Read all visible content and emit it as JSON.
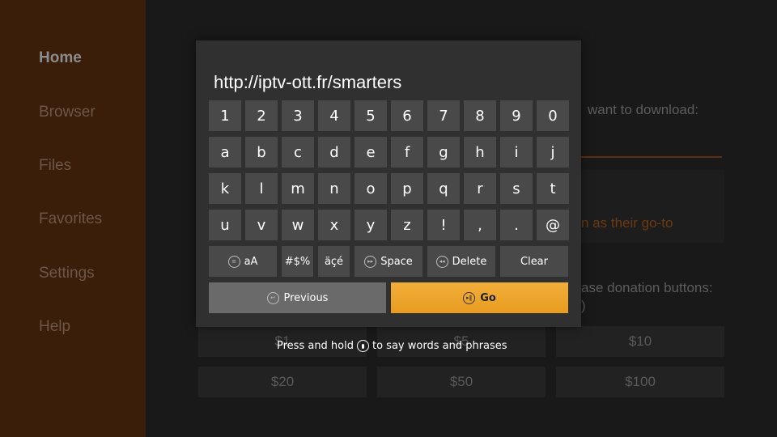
{
  "sidebar": {
    "items": [
      {
        "label": "Home",
        "active": true
      },
      {
        "label": "Browser"
      },
      {
        "label": "Files"
      },
      {
        "label": "Favorites"
      },
      {
        "label": "Settings"
      },
      {
        "label": "Help"
      }
    ]
  },
  "background": {
    "download_prompt": "want to download:",
    "go_to_text": "n as their go-to",
    "donation_prompt": "ase donation buttons:",
    "donation_paren": ")",
    "donations": [
      "$1",
      "$5",
      "$10",
      "$20",
      "$50",
      "$100"
    ]
  },
  "dialog": {
    "url": "http://iptv-ott.fr/smarters",
    "rows": [
      [
        "1",
        "2",
        "3",
        "4",
        "5",
        "6",
        "7",
        "8",
        "9",
        "0"
      ],
      [
        "a",
        "b",
        "c",
        "d",
        "e",
        "f",
        "g",
        "h",
        "i",
        "j"
      ],
      [
        "k",
        "l",
        "m",
        "n",
        "o",
        "p",
        "q",
        "r",
        "s",
        "t"
      ],
      [
        "u",
        "v",
        "w",
        "x",
        "y",
        "z",
        "!",
        ",",
        ".",
        "@"
      ]
    ],
    "case_label": "aA",
    "symbols_label": "#$%",
    "accents_label": "äçé",
    "space_label": "Space",
    "delete_label": "Delete",
    "clear_label": "Clear",
    "previous_label": "Previous",
    "go_label": "Go"
  },
  "hint": {
    "before": "Press and hold",
    "after": "to say words and phrases"
  },
  "colors": {
    "accent": "#e89c20",
    "sidebar_bg": "#3a1e09",
    "dialog_bg": "#303030",
    "key_bg": "#494949"
  }
}
